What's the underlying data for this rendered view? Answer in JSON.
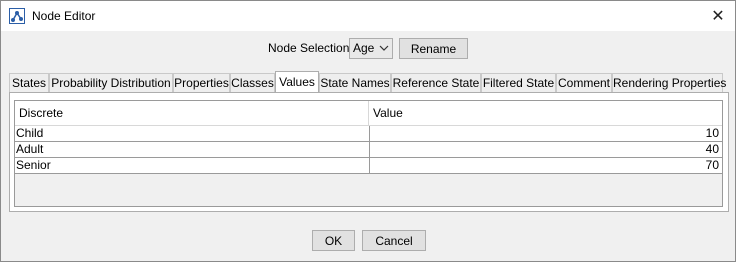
{
  "window": {
    "title": "Node Editor",
    "close_glyph": "✕"
  },
  "node_selection": {
    "label": "Node Selection:",
    "selected": "Age",
    "rename_label": "Rename"
  },
  "tabs": [
    {
      "label": "States"
    },
    {
      "label": "Probability Distribution"
    },
    {
      "label": "Properties"
    },
    {
      "label": "Classes"
    },
    {
      "label": "Values",
      "active": true
    },
    {
      "label": "State Names"
    },
    {
      "label": "Reference State"
    },
    {
      "label": "Filtered State"
    },
    {
      "label": "Comment"
    },
    {
      "label": "Rendering Properties"
    }
  ],
  "table": {
    "columns": [
      "Discrete",
      "Value"
    ],
    "rows": [
      {
        "name": "Child",
        "value": "10"
      },
      {
        "name": "Adult",
        "value": "40"
      },
      {
        "name": "Senior",
        "value": "70"
      }
    ]
  },
  "footer": {
    "ok_label": "OK",
    "cancel_label": "Cancel"
  },
  "icons": {
    "app": "node-editor-icon",
    "close": "close-icon",
    "dropdown": "chevron-down-icon"
  }
}
